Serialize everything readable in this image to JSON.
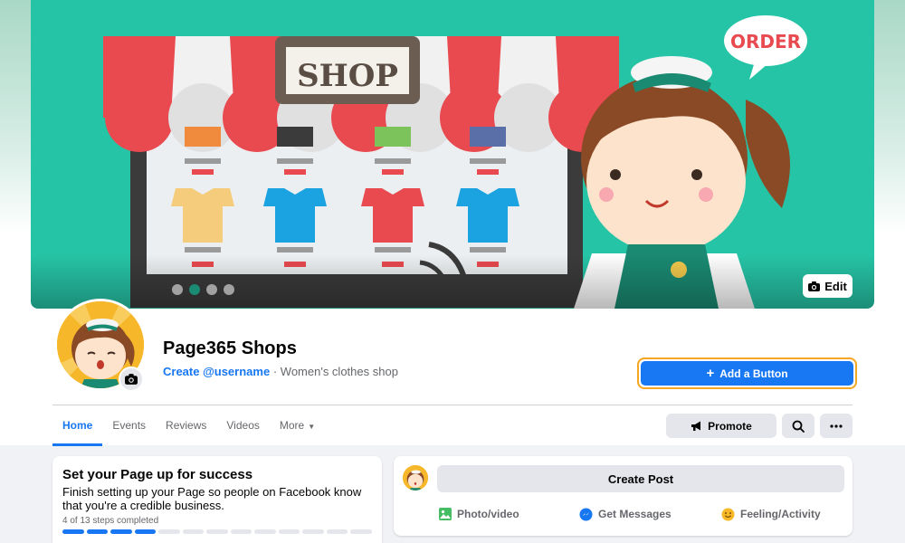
{
  "cover": {
    "edit_label": "Edit",
    "carousel_dots": 4,
    "active_dot": 1,
    "illustration": {
      "sign_text": "SHOP",
      "bubble_text": "ORDER"
    }
  },
  "profile": {
    "name": "Page365 Shops",
    "username_link": "Create @username",
    "separator": "·",
    "category": "Women's clothes shop"
  },
  "actions": {
    "add_button_label": "Add a Button",
    "promote_label": "Promote"
  },
  "tabs": [
    {
      "label": "Home",
      "active": true
    },
    {
      "label": "Events",
      "active": false
    },
    {
      "label": "Reviews",
      "active": false
    },
    {
      "label": "Videos",
      "active": false
    },
    {
      "label": "More",
      "active": false
    }
  ],
  "setup_card": {
    "title": "Set your Page up for success",
    "description": "Finish setting up your Page so people on Facebook know that you're a credible business.",
    "steps_text": "4 of 13 steps completed",
    "steps_completed": 4,
    "steps_total": 13
  },
  "create_post": {
    "button_label": "Create Post",
    "actions": [
      {
        "label": "Photo/video",
        "icon": "photo-icon"
      },
      {
        "label": "Get Messages",
        "icon": "messenger-icon"
      },
      {
        "label": "Feeling/Activity",
        "icon": "smiley-icon"
      }
    ]
  },
  "colors": {
    "brand_blue": "#1877f2",
    "highlight_outline": "#f5a623",
    "cover_teal": "#26c4a6"
  }
}
